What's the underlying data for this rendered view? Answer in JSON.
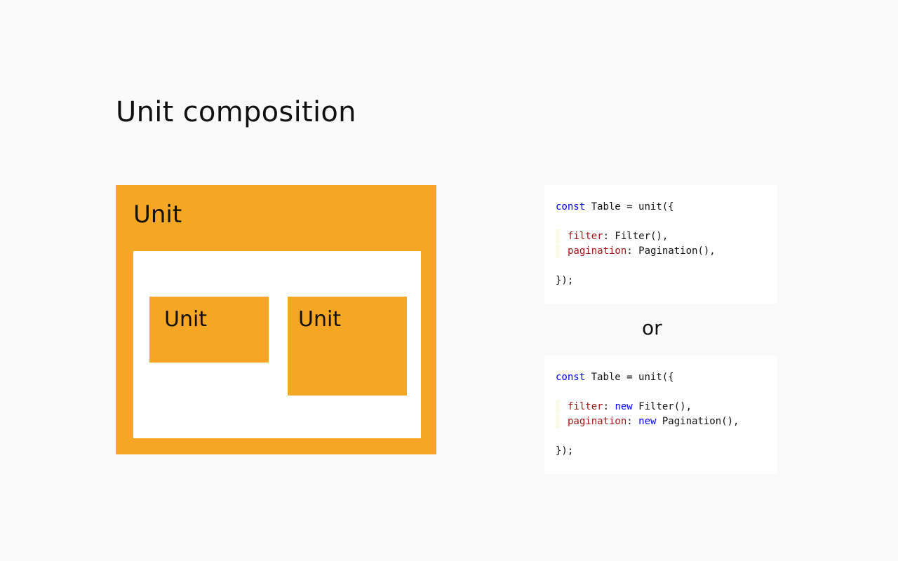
{
  "title": "Unit composition",
  "diagram": {
    "outer_label": "Unit",
    "inner_unit_1_label": "Unit",
    "inner_unit_2_label": "Unit",
    "accent_color": "#f5a623"
  },
  "separator": "or",
  "code_example_1": {
    "line1_kw": "const",
    "line1_rest": " Table = unit({",
    "line2_prop": "filter",
    "line2_rest": ": Filter(),",
    "line3_prop": "pagination",
    "line3_rest": ": Pagination(),",
    "line4": "});"
  },
  "code_example_2": {
    "line1_kw": "const",
    "line1_rest": " Table = unit({",
    "line2_prop": "filter",
    "line2_sep": ": ",
    "line2_kw": "new",
    "line2_rest": " Filter(),",
    "line3_prop": "pagination",
    "line3_sep": ": ",
    "line3_kw": "new",
    "line3_rest": " Pagination(),",
    "line4": "});"
  }
}
